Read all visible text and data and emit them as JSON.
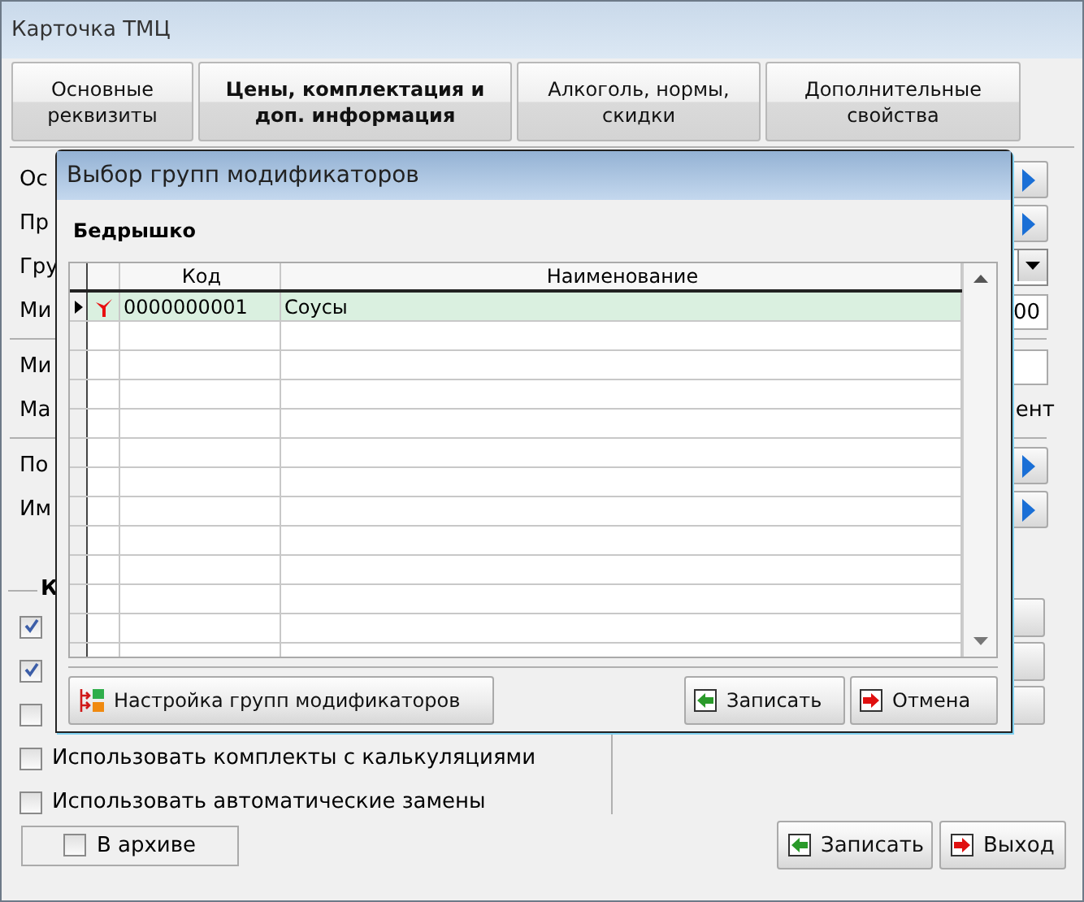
{
  "window": {
    "title": "Карточка ТМЦ"
  },
  "tabs": [
    {
      "label": "Основные реквизиты",
      "selected": false
    },
    {
      "label": "Цены, комплектация и доп. информация",
      "selected": true
    },
    {
      "label": "Алкоголь, нормы, скидки",
      "selected": false
    },
    {
      "label": "Дополнительные свойства",
      "selected": false
    }
  ],
  "form_sections": [
    [
      {
        "label": "Ос",
        "kind": "arrow"
      },
      {
        "label": "Пр",
        "kind": "arrow"
      },
      {
        "label": "Гру",
        "kind": "dropdown"
      },
      {
        "label": "Ми",
        "kind": "field",
        "value": "00"
      }
    ],
    [
      {
        "label": "Ми",
        "kind": "field"
      },
      {
        "label": "Ма",
        "kind": "text",
        "value": "ент"
      }
    ],
    [
      {
        "label": "По",
        "kind": "arrow"
      },
      {
        "label": "Им",
        "kind": "arrow"
      }
    ]
  ],
  "options_group": {
    "title": "К",
    "options": [
      {
        "checked": true
      },
      {
        "checked": true
      },
      {
        "checked": false
      },
      {
        "label": "Использовать комплекты с калькуляциями",
        "checked": false
      },
      {
        "label": "Использовать автоматические замены",
        "checked": false
      }
    ]
  },
  "archive": {
    "label": "В архиве",
    "checked": false
  },
  "buttons": [
    {
      "label": "Записать",
      "kind": "save"
    },
    {
      "label": "Выход",
      "kind": "cancel"
    }
  ],
  "dialog": {
    "title": "Выбор групп модификаторов",
    "item": "Бедрышко",
    "table": {
      "columns": [
        "Код",
        "Наименование"
      ],
      "rows": [
        {
          "code": "0000000001",
          "name": "Соусы",
          "checked": true,
          "selected": true
        }
      ]
    },
    "buttons": [
      {
        "label": "Настройка групп модификаторов",
        "kind": "settings"
      },
      {
        "label": "Записать",
        "kind": "save"
      },
      {
        "label": "Отмена",
        "kind": "cancel"
      }
    ]
  }
}
